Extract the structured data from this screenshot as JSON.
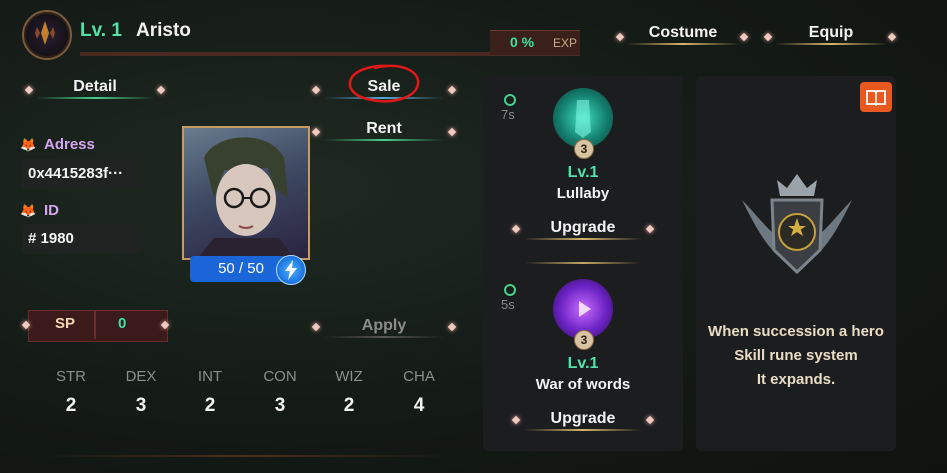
{
  "hero": {
    "level": "Lv. 1",
    "name": "Aristo"
  },
  "exp": {
    "percent": "0 %",
    "label": "EXP",
    "fraction": 0
  },
  "top_buttons": {
    "costume": "Costume",
    "equip": "Equip"
  },
  "left_buttons": {
    "detail": "Detail",
    "sale": "Sale",
    "rent": "Rent",
    "apply": "Apply"
  },
  "info": {
    "address_label": "Adress",
    "address_value": "0x4415283f···",
    "id_label": "ID",
    "id_value": "# 1980"
  },
  "energy": {
    "text": "50 / 50",
    "current": 50,
    "max": 50
  },
  "sp": {
    "label": "SP",
    "value": "0"
  },
  "stats": [
    {
      "name": "STR",
      "value": "2"
    },
    {
      "name": "DEX",
      "value": "3"
    },
    {
      "name": "INT",
      "value": "2"
    },
    {
      "name": "CON",
      "value": "3"
    },
    {
      "name": "WIZ",
      "value": "2"
    },
    {
      "name": "CHA",
      "value": "4"
    }
  ],
  "skills": [
    {
      "cooldown": "7s",
      "badge": "3",
      "level": "Lv.1",
      "name": "Lullaby",
      "button": "Upgrade",
      "icon": "lullaby-skill-icon",
      "color": "#1fb5a0"
    },
    {
      "cooldown": "5s",
      "badge": "3",
      "level": "Lv.1",
      "name": "War of words",
      "button": "Upgrade",
      "icon": "war-of-words-skill-icon",
      "color": "#7a2fd0"
    }
  ],
  "rune": {
    "line1": "When succession a hero",
    "line2": "Skill rune system",
    "line3": "It expands."
  },
  "colors": {
    "accent_green": "#52e3a8",
    "annotation_red": "#e01818",
    "energy_blue": "#1a66d9",
    "book_orange": "#e8581f"
  }
}
